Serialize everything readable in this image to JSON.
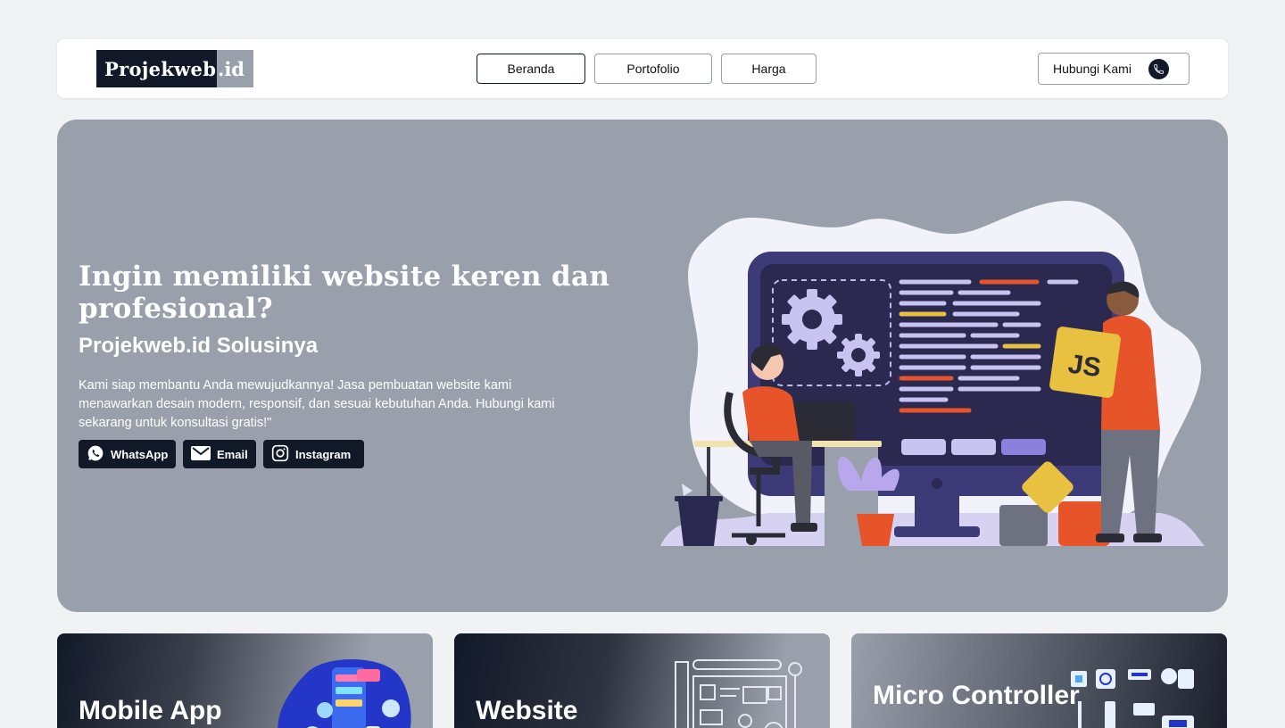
{
  "brand": {
    "logo_main": "Projekweb",
    "logo_tld": ".id"
  },
  "nav": {
    "items": [
      {
        "label": "Beranda",
        "active": true
      },
      {
        "label": "Portofolio",
        "active": false
      },
      {
        "label": "Harga",
        "active": false
      }
    ],
    "contact_label": "Hubungi Kami",
    "contact_icon": "phone-icon"
  },
  "hero": {
    "title": "Ingin memiliki website keren dan profesional?",
    "subtitle": "Projekweb.id Solusinya",
    "description": "Kami siap membantu Anda mewujudkannya! Jasa pembuatan website kami menawarkan desain modern, responsif, dan sesuai kebutuhan Anda. Hubungi kami sekarang untuk konsultasi gratis!\"",
    "socials": [
      {
        "label": "WhatsApp",
        "icon": "whatsapp-icon"
      },
      {
        "label": "Email",
        "icon": "mail-icon"
      },
      {
        "label": "Instagram",
        "icon": "instagram-icon"
      }
    ],
    "illustration_text": "JS"
  },
  "services": [
    {
      "title": "Mobile App"
    },
    {
      "title": "Website"
    },
    {
      "title": "Micro Controller"
    }
  ],
  "colors": {
    "primary": "#111827",
    "muted": "#9aa0ab",
    "background": "#f1f2f4",
    "accent_orange": "#e8542a",
    "accent_purple": "#3d3a78"
  }
}
